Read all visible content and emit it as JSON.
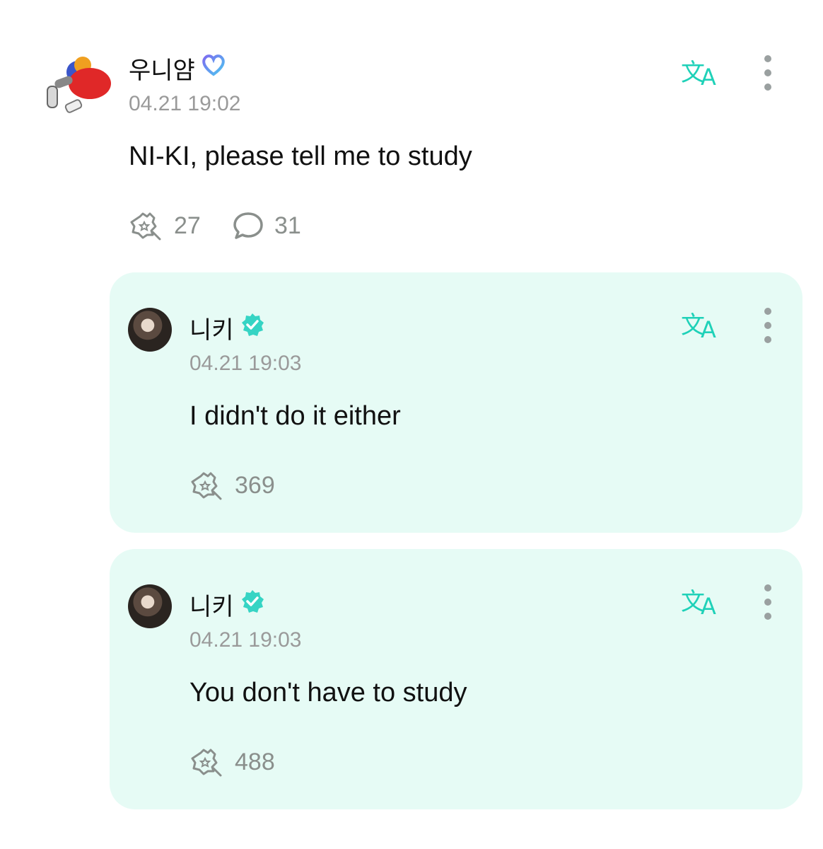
{
  "post": {
    "author": "우니얌",
    "badge_icon": "heart-badge-icon",
    "time": "04.21 19:02",
    "text": "NI-KI, please tell me to study",
    "like_count": "27",
    "comment_count": "31"
  },
  "replies": [
    {
      "author": "니키",
      "badge_icon": "verified-badge-icon",
      "time": "04.21 19:03",
      "text": "I didn't do it either",
      "like_count": "369"
    },
    {
      "author": "니키",
      "badge_icon": "verified-badge-icon",
      "time": "04.21 19:03",
      "text": "You don't have to study",
      "like_count": "488"
    }
  ],
  "colors": {
    "accent": "#1fd1b8",
    "reply_bg": "#e6fbf5",
    "meta_gray": "#9a9a9a"
  }
}
